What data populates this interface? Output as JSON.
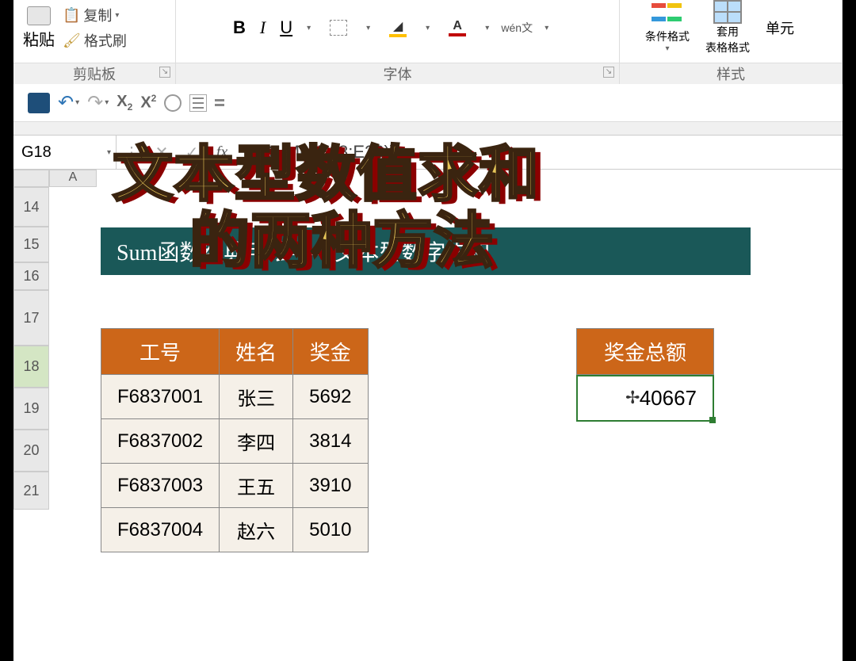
{
  "ribbon": {
    "paste": "粘贴",
    "copy": "复制",
    "format_painter": "格式刷",
    "clipboard_group": "剪贴板",
    "font_group": "字体",
    "styles_group": "样式",
    "cond_fmt": "条件格式",
    "table_fmt_1": "套用",
    "table_fmt_2": "表格格式",
    "cell_style": "单元",
    "wen_top": "wén",
    "wen_bot": "文"
  },
  "name_box": "G18",
  "formula": "{=SUM(--E18:E26)}",
  "col_A": "A",
  "rows": [
    "14",
    "15",
    "16",
    "17",
    "18",
    "19",
    "20",
    "21"
  ],
  "selected_row": "18",
  "banner": "Sum函数经典用法——文本型数字求和",
  "headers": {
    "id": "工号",
    "name": "姓名",
    "bonus": "奖金",
    "total": "奖金总额"
  },
  "data": [
    {
      "id": "F6837001",
      "name": "张三",
      "bonus": "5692"
    },
    {
      "id": "F6837002",
      "name": "李四",
      "bonus": "3814"
    },
    {
      "id": "F6837003",
      "name": "王五",
      "bonus": "3910"
    },
    {
      "id": "F6837004",
      "name": "赵六",
      "bonus": "5010"
    }
  ],
  "total_value": "40667",
  "overlay": {
    "l1": "文本型数值求和",
    "l2": "的两种方法"
  }
}
